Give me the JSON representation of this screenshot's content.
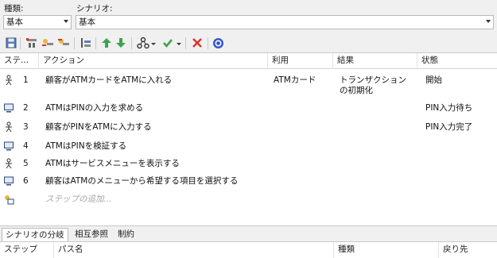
{
  "filters": {
    "type_label": "種類:",
    "type_value": "基本",
    "scenario_label": "シナリオ:",
    "scenario_value": "基本"
  },
  "toolbar": {
    "icons": [
      "save-icon",
      "new-step-icon",
      "insert-step-icon",
      "delete-step-icon",
      "indent-icon",
      "move-up-icon",
      "move-down-icon",
      "generate-icon",
      "check-icon",
      "delete-icon",
      "help-icon"
    ]
  },
  "grid": {
    "columns": [
      "ステ...",
      "アクション",
      "利用",
      "結果",
      "状態"
    ],
    "rows": [
      {
        "actor": "user",
        "step": "1",
        "action": "顧客がATMカードをATMに入れる",
        "uses": "ATMカード",
        "result_line1": "トランザクション",
        "result_line2": "の初期化",
        "state": "開始"
      },
      {
        "actor": "system",
        "step": "2",
        "action": "ATMはPINの入力を求める",
        "uses": "",
        "result_line1": "",
        "result_line2": "",
        "state": "PIN入力待ち"
      },
      {
        "actor": "user",
        "step": "3",
        "action": "顧客がPINをATMに入力する",
        "uses": "",
        "result_line1": "",
        "result_line2": "",
        "state": "PIN入力完了"
      },
      {
        "actor": "system",
        "step": "4",
        "action": "ATMはPINを検証する",
        "uses": "",
        "result_line1": "",
        "result_line2": "",
        "state": ""
      },
      {
        "actor": "user",
        "step": "5",
        "action": "ATMはサービスメニューを表示する",
        "uses": "",
        "result_line1": "",
        "result_line2": "",
        "state": ""
      },
      {
        "actor": "system",
        "step": "6",
        "action": "顧客はATMのメニューから希望する項目を選択する",
        "uses": "",
        "result_line1": "",
        "result_line2": "",
        "state": ""
      }
    ],
    "add_step_placeholder": "ステップの追加..."
  },
  "bottom_tabs": [
    "シナリオの分岐",
    "相互参照",
    "制約"
  ],
  "bottom_columns": [
    "ステップ",
    "パス名",
    "種類",
    "戻り先"
  ],
  "colors": {
    "accent_red": "#d9342b",
    "accent_green": "#3fa34d",
    "help_blue": "#3355cc"
  }
}
